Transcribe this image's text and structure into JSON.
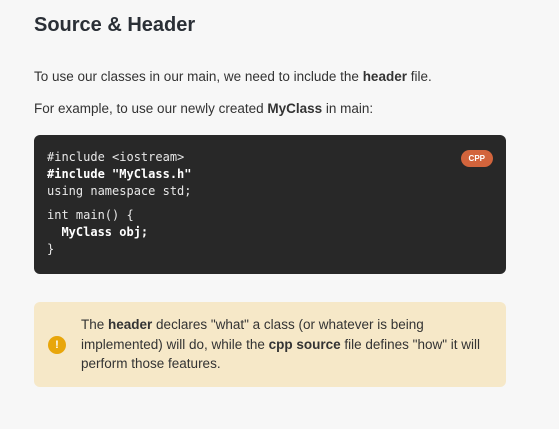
{
  "title": "Source & Header",
  "para1": [
    {
      "t": "To use our classes in our main, we need to include the "
    },
    {
      "t": "header",
      "b": true
    },
    {
      "t": " file."
    }
  ],
  "para2": [
    {
      "t": "For example, to use our newly created "
    },
    {
      "t": "MyClass",
      "b": true
    },
    {
      "t": " in main:"
    }
  ],
  "code": {
    "language": "CPP",
    "lines": [
      {
        "t": "#include <iostream>"
      },
      {
        "t": "#include \"MyClass.h\"",
        "b": true
      },
      {
        "t": "using namespace std;"
      },
      {
        "gap": true
      },
      {
        "t": "int main() {"
      },
      {
        "t": "  MyClass obj;",
        "b": true
      },
      {
        "t": "}"
      }
    ]
  },
  "note": {
    "icon": "warning-icon",
    "segments": [
      {
        "t": "The "
      },
      {
        "t": "header",
        "b": true
      },
      {
        "t": " declares \"what\" a class (or whatever is being implemented) will do, while the "
      },
      {
        "t": "cpp source",
        "b": true
      },
      {
        "t": " file defines \"how\" it will perform those features."
      }
    ]
  }
}
